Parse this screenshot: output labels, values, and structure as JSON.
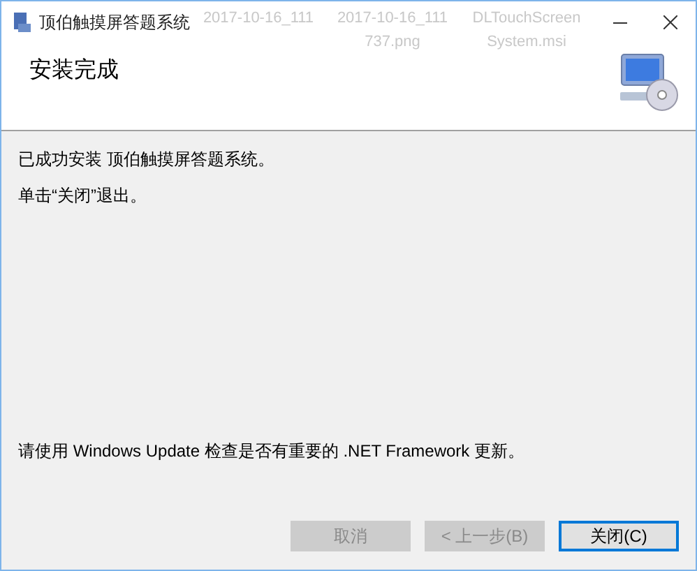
{
  "window": {
    "title": "顶伯触摸屏答题系统"
  },
  "desktop_labels": [
    {
      "lines": [
        "2017-10-16_111"
      ]
    },
    {
      "lines": [
        "2017-10-16_111",
        "737.png"
      ]
    },
    {
      "lines": [
        "DLTouchScreen",
        "System.msi"
      ]
    }
  ],
  "header": {
    "title": "安装完成"
  },
  "messages": [
    "已成功安装 顶伯触摸屏答题系统。",
    "单击“关闭”退出。"
  ],
  "note": "请使用 Windows Update 检查是否有重要的 .NET Framework 更新。",
  "buttons": [
    {
      "label": "取消",
      "disabled": true,
      "selected": false
    },
    {
      "label": "< 上一步(B)",
      "disabled": true,
      "selected": false
    },
    {
      "label": "关闭(C)",
      "disabled": false,
      "selected": true
    }
  ]
}
